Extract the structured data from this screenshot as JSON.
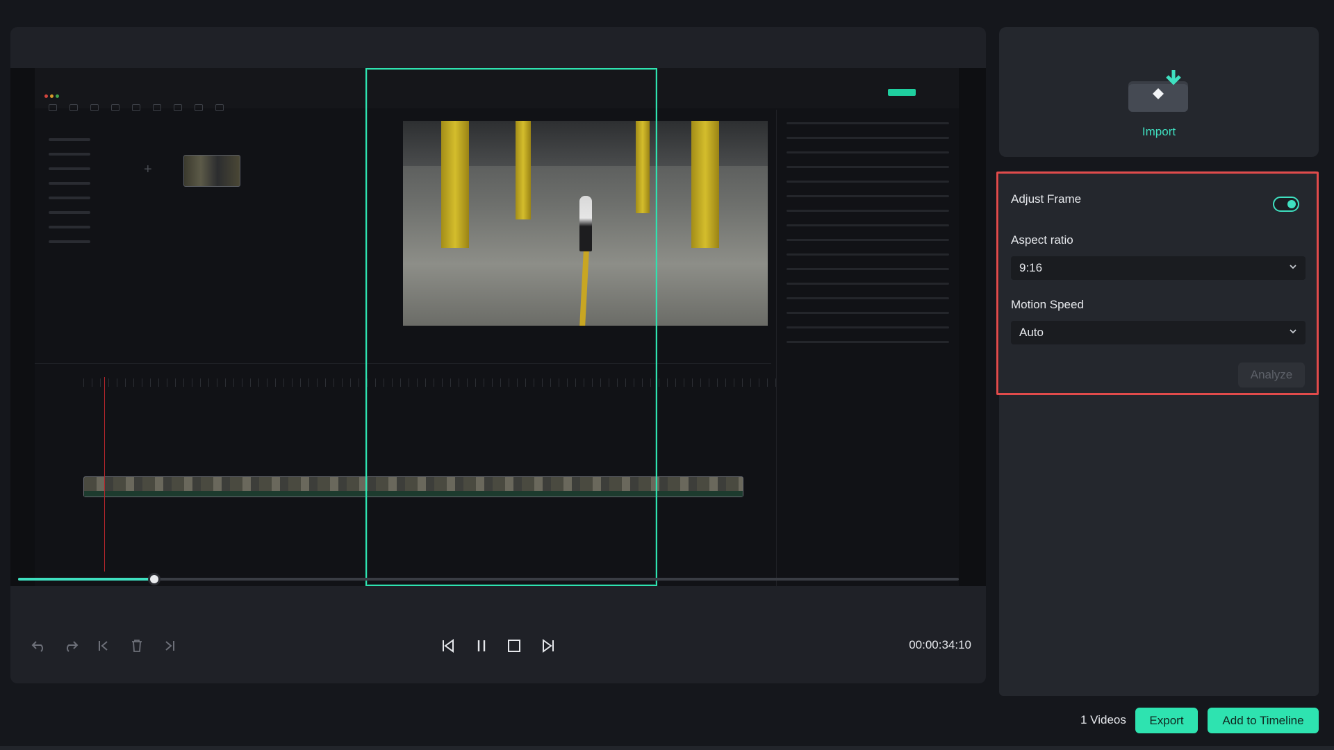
{
  "window": {
    "title": ""
  },
  "preview": {
    "timecode": "00:00:34:10",
    "progress_fraction": 0.145
  },
  "import": {
    "label": "Import"
  },
  "settings": {
    "adjust_frame_label": "Adjust Frame",
    "adjust_frame_enabled": true,
    "aspect_ratio_label": "Aspect ratio",
    "aspect_ratio_value": "9:16",
    "motion_speed_label": "Motion Speed",
    "motion_speed_value": "Auto",
    "analyze_label": "Analyze"
  },
  "footer": {
    "videos_count": "1 Videos",
    "export_label": "Export",
    "add_to_timeline_label": "Add to Timeline"
  },
  "colors": {
    "accent": "#2ee3b0",
    "highlight": "#e14b4b",
    "background": "#15171c",
    "panel": "#24272d"
  },
  "icons": {
    "undo": "undo-icon",
    "redo": "redo-icon",
    "prev_mark": "jump-start-icon",
    "delete": "trash-icon",
    "next_mark": "jump-end-icon",
    "prev_frame": "previous-frame-icon",
    "pause": "pause-icon",
    "stop": "stop-icon",
    "next_frame": "next-frame-icon",
    "import": "import-folder-icon",
    "chevron": "chevron-down-icon"
  }
}
